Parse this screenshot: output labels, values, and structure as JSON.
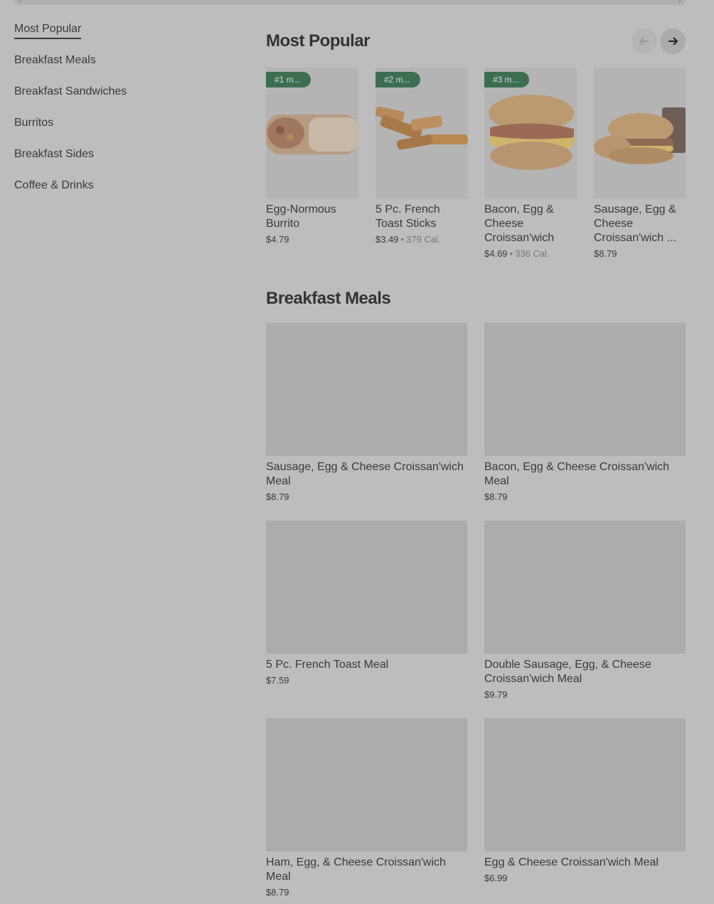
{
  "sidebar": {
    "items": [
      {
        "label": "Most Popular",
        "active": true
      },
      {
        "label": "Breakfast Meals"
      },
      {
        "label": "Breakfast Sandwiches"
      },
      {
        "label": "Burritos"
      },
      {
        "label": "Breakfast Sides"
      },
      {
        "label": "Coffee & Drinks"
      }
    ]
  },
  "most_popular": {
    "title": "Most Popular",
    "nav": {
      "prev_icon": "arrow-left-icon",
      "next_icon": "arrow-right-icon"
    },
    "items": [
      {
        "badge": "#1 m...",
        "name": "Egg-Normous Burrito",
        "price": "$4.79",
        "calories": ""
      },
      {
        "badge": "#2 m...",
        "name": "5 Pc. French Toast Sticks",
        "price": "$3.49",
        "calories": "379 Cal."
      },
      {
        "badge": "#3 m...",
        "name": "Bacon, Egg & Cheese Croissan'wich",
        "price": "$4.69",
        "calories": "336 Cal."
      },
      {
        "badge": "",
        "name": "Sausage, Egg & Cheese Croissan'wich ...",
        "price": "$8.79",
        "calories": ""
      }
    ]
  },
  "breakfast_meals": {
    "title": "Breakfast Meals",
    "items": [
      {
        "name": "Sausage, Egg & Cheese Croissan'wich Meal",
        "price": "$8.79"
      },
      {
        "name": "Bacon, Egg & Cheese Croissan'wich Meal",
        "price": "$8.79"
      },
      {
        "name": "5 Pc. French Toast Meal",
        "price": "$7.59"
      },
      {
        "name": "Double Sausage, Egg, & Cheese Croissan'wich Meal",
        "price": "$9.79"
      },
      {
        "name": "Ham, Egg, & Cheese Croissan'wich Meal",
        "price": "$8.79"
      },
      {
        "name": "Egg & Cheese Croissan'wich Meal",
        "price": "$6.99"
      }
    ]
  },
  "colors": {
    "overlay_bg": "#bdbdbd",
    "badge_green": "#3d6e52",
    "text": "#3a3a3a"
  }
}
